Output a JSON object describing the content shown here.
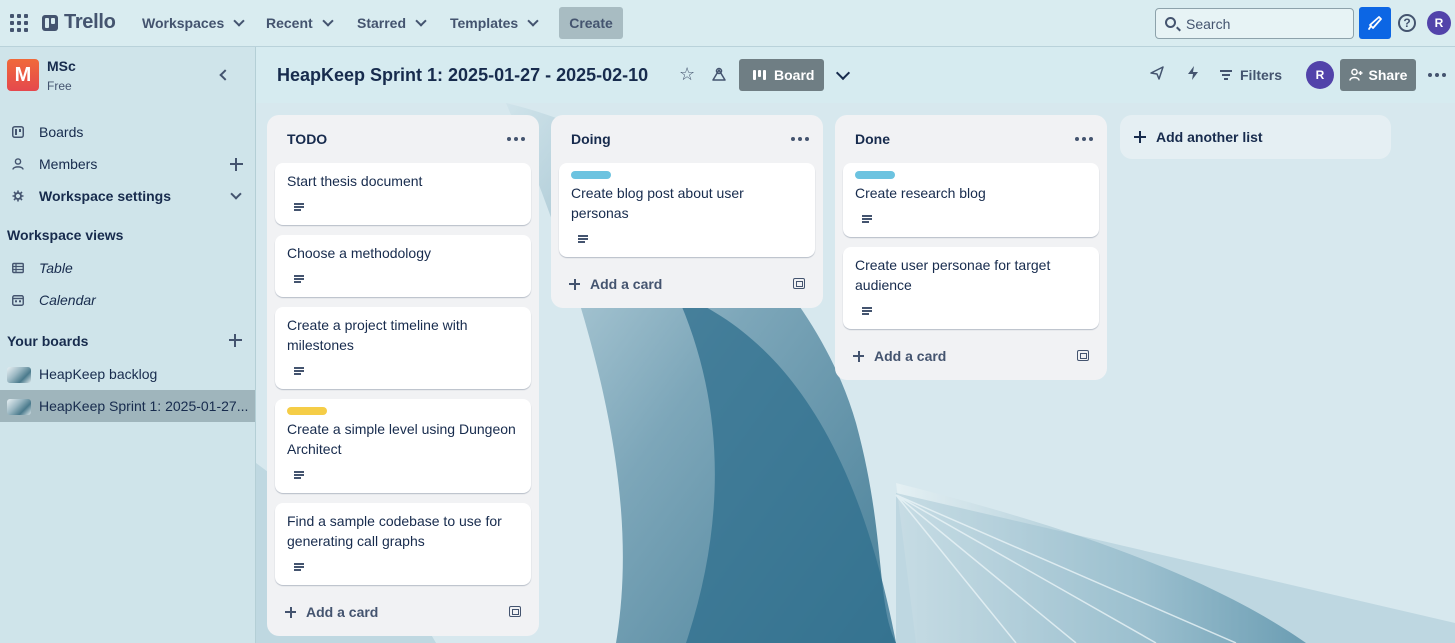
{
  "topbar": {
    "logo": "Trello",
    "nav": [
      "Workspaces",
      "Recent",
      "Starred",
      "Templates"
    ],
    "create": "Create",
    "search_placeholder": "Search",
    "avatar": "R"
  },
  "sidebar": {
    "workspace_initial": "M",
    "workspace_name": "MSc",
    "workspace_plan": "Free",
    "items": [
      {
        "label": "Boards"
      },
      {
        "label": "Members"
      },
      {
        "label": "Workspace settings"
      }
    ],
    "views_title": "Workspace views",
    "views": [
      {
        "label": "Table"
      },
      {
        "label": "Calendar"
      }
    ],
    "boards_title": "Your boards",
    "boards": [
      {
        "label": "HeapKeep backlog"
      },
      {
        "label": "HeapKeep Sprint 1: 2025-01-27..."
      }
    ]
  },
  "board": {
    "title": "HeapKeep Sprint 1: 2025-01-27 - 2025-02-10",
    "view_label": "Board",
    "filters": "Filters",
    "avatar": "R",
    "share": "Share"
  },
  "lists": [
    {
      "title": "TODO",
      "add_card": "Add a card",
      "cards": [
        {
          "title": "Start thesis document"
        },
        {
          "title": "Choose a methodology"
        },
        {
          "title": "Create a project timeline with milestones"
        },
        {
          "title": "Create a simple level using Dungeon Architect",
          "label_color": "#f5cd47"
        },
        {
          "title": "Find a sample codebase to use for generating call graphs"
        }
      ]
    },
    {
      "title": "Doing",
      "add_card": "Add a card",
      "cards": [
        {
          "title": "Create blog post about user personas",
          "label_color": "#6cc3e0"
        }
      ]
    },
    {
      "title": "Done",
      "add_card": "Add a card",
      "cards": [
        {
          "title": "Create research blog",
          "label_color": "#6cc3e0"
        },
        {
          "title": "Create user personae for target audience"
        }
      ]
    }
  ],
  "add_list": "Add another list"
}
